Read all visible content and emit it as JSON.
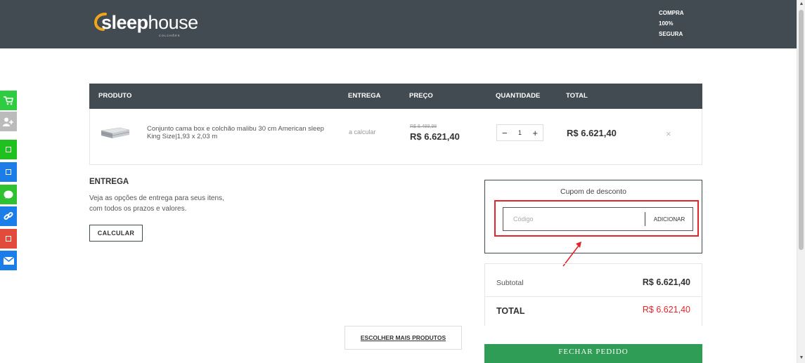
{
  "header": {
    "logo_bold": "sleep",
    "logo_light": "house",
    "logo_sub": "COLCHÕES",
    "secure_lines": [
      "COMPRA",
      "100%",
      "SEGURA"
    ],
    "background": "#434b52"
  },
  "social_bar": [
    {
      "icon": "cart-plus-icon",
      "color": "#2ecc40"
    },
    {
      "icon": "user-plus-icon",
      "color": "#bbbbbb"
    },
    {
      "icon": "whatsapp-icon",
      "color": "#1fc11f"
    },
    {
      "icon": "facebook-icon",
      "color": "#1a7de8"
    },
    {
      "icon": "messenger-icon",
      "color": "#2fc12f"
    },
    {
      "icon": "link-icon",
      "color": "#1a7de8"
    },
    {
      "icon": "google-plus-icon",
      "color": "#e24a3c"
    },
    {
      "icon": "mail-icon",
      "color": "#1a7de8"
    }
  ],
  "cart": {
    "headers": {
      "product": "PRODUTO",
      "delivery": "ENTREGA",
      "price": "PREÇO",
      "quantity": "QUANTIDADE",
      "total": "TOTAL"
    },
    "item": {
      "name": "Conjunto cama box e colchão malibu 30 cm American sleep King Size|1,93 x 2,03 m",
      "delivery": "a calcular",
      "price_old": "R$ 8.488,98",
      "price_new": "R$ 6.621,40",
      "quantity": "1",
      "minus": "−",
      "plus": "+",
      "total": "R$ 6.621,40",
      "remove": "×"
    }
  },
  "shipping": {
    "title": "ENTREGA",
    "description": "Veja as opções de entrega para seus itens, com todos os prazos e valores.",
    "button": "CALCULAR"
  },
  "coupon": {
    "title": "Cupom de desconto",
    "placeholder": "Código",
    "button": "ADICIONAR",
    "highlight_color": "#e0262b"
  },
  "summary": {
    "subtotal_label": "Subtotal",
    "subtotal_value": "R$ 6.621,40",
    "total_label": "TOTAL",
    "total_value": "R$ 6.621,40"
  },
  "actions": {
    "more_products": "ESCOLHER MAIS PRODUTOS",
    "close_order": "FECHAR PEDIDO",
    "close_order_color": "#2f9d55"
  }
}
